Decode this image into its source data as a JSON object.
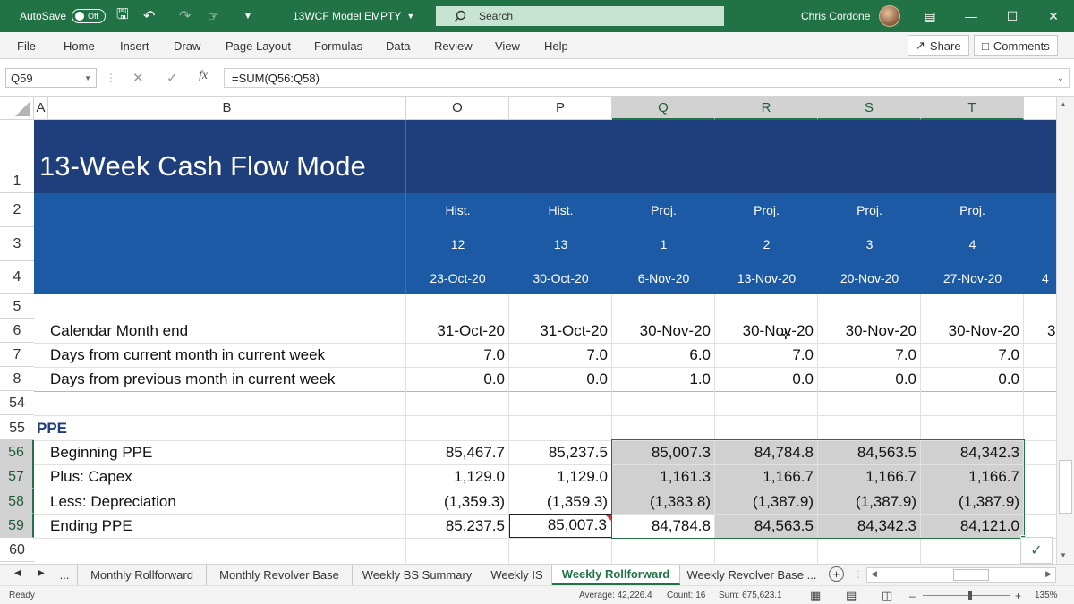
{
  "titlebar": {
    "autosave_label": "AutoSave",
    "autosave_state": "Off",
    "file_name": "13WCF Model EMPTY",
    "search_placeholder": "Search",
    "user_name": "Chris Cordone"
  },
  "ribbon": {
    "tabs": [
      "File",
      "Home",
      "Insert",
      "Draw",
      "Page Layout",
      "Formulas",
      "Data",
      "Review",
      "View",
      "Help"
    ],
    "share_label": "Share",
    "comments_label": "Comments"
  },
  "formula_bar": {
    "name_box": "Q59",
    "formula": "=SUM(Q56:Q58)"
  },
  "grid": {
    "columns": [
      "A",
      "B",
      "O",
      "P",
      "Q",
      "R",
      "S",
      "T"
    ],
    "rows": [
      "1",
      "2",
      "3",
      "4",
      "5",
      "6",
      "7",
      "8",
      "54",
      "55",
      "56",
      "57",
      "58",
      "59",
      "60"
    ],
    "title": "13-Week Cash Flow Mode",
    "header_row2": [
      "Hist.",
      "Hist.",
      "Proj.",
      "Proj.",
      "Proj.",
      "Proj."
    ],
    "header_row3": [
      "12",
      "13",
      "1",
      "2",
      "3",
      "4"
    ],
    "header_row4": [
      "23-Oct-20",
      "30-Oct-20",
      "6-Nov-20",
      "13-Nov-20",
      "20-Nov-20",
      "27-Nov-20"
    ],
    "overflow_col_row4": "4",
    "overflow_col_row6": "3",
    "lines": [
      {
        "label": "Calendar Month end",
        "values": [
          "31-Oct-20",
          "31-Oct-20",
          "30-Nov-20",
          "30-Nov-20",
          "30-Nov-20",
          "30-Nov-20"
        ]
      },
      {
        "label": "Days from current month in current week",
        "values": [
          "7.0",
          "7.0",
          "6.0",
          "7.0",
          "7.0",
          "7.0"
        ]
      },
      {
        "label": "Days from previous month in current week",
        "values": [
          "0.0",
          "0.0",
          "1.0",
          "0.0",
          "0.0",
          "0.0"
        ]
      }
    ],
    "section_label": "PPE",
    "ppe_lines": [
      {
        "label": "Beginning PPE",
        "values": [
          "85,467.7",
          "85,237.5",
          "85,007.3",
          "84,784.8",
          "84,563.5",
          "84,342.3"
        ]
      },
      {
        "label": "Plus: Capex",
        "values": [
          "1,129.0",
          "1,129.0",
          "1,161.3",
          "1,166.7",
          "1,166.7",
          "1,166.7"
        ]
      },
      {
        "label": "Less: Depreciation",
        "values": [
          "(1,359.3)",
          "(1,359.3)",
          "(1,383.8)",
          "(1,387.9)",
          "(1,387.9)",
          "(1,387.9)"
        ]
      },
      {
        "label": "Ending PPE",
        "values": [
          "85,237.5",
          "85,007.3",
          "84,784.8",
          "84,563.5",
          "84,342.3",
          "84,121.0"
        ]
      }
    ]
  },
  "sheet_tabs": {
    "more": "...",
    "tabs": [
      "Monthly Rollforward",
      "Monthly Revolver Base",
      "Weekly BS Summary",
      "Weekly IS",
      "Weekly Rollforward",
      "Weekly Revolver Base ..."
    ],
    "active": "Weekly Rollforward"
  },
  "status": {
    "ready": "Ready",
    "average": "Average: 42,226.4",
    "count": "Count: 16",
    "sum": "Sum: 675,623.1",
    "zoom": "135%"
  },
  "colors": {
    "excel_green": "#217346",
    "title_band": "#1f3e7c",
    "header_band": "#1c5aa6",
    "section_text": "#1f3e7c",
    "selection_fill": "#d0d0d0"
  }
}
